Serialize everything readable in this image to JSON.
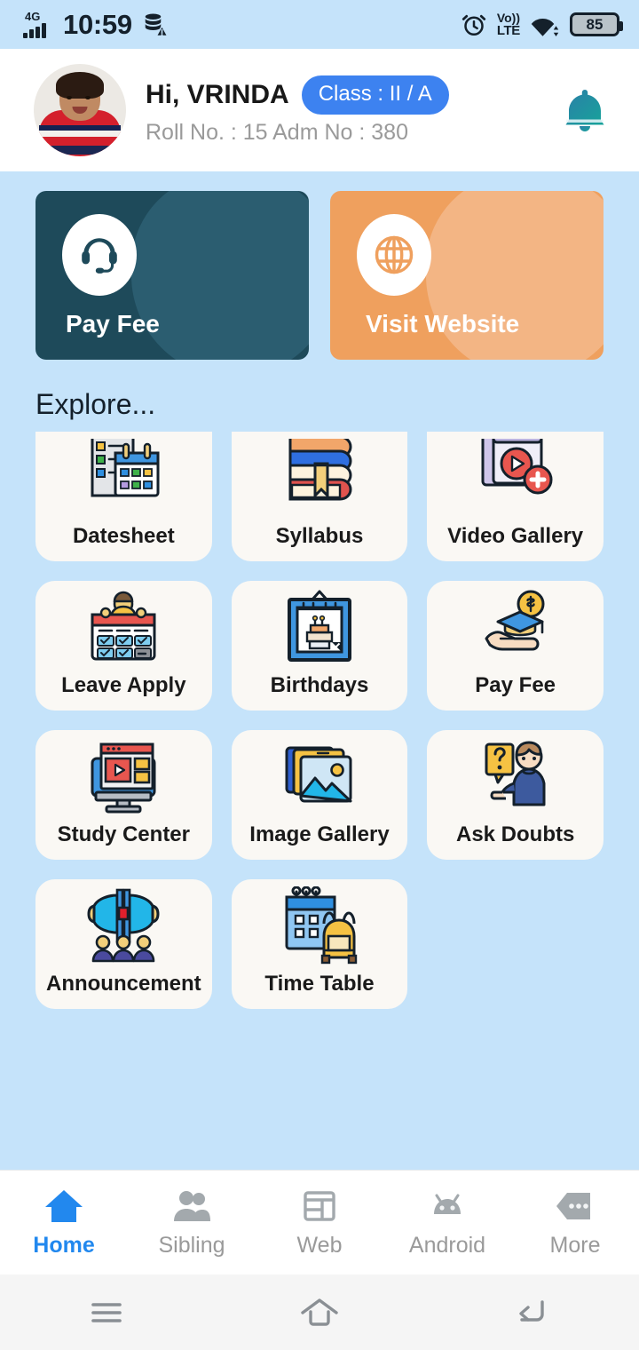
{
  "statusbar": {
    "network": "4G",
    "time": "10:59",
    "data_icon": "data-saver-off-icon",
    "alarm_icon": "alarm-icon",
    "volte_top": "Vo))",
    "volte_bottom": "LTE",
    "wifi_icon": "wifi-icon",
    "battery_level": "85"
  },
  "header": {
    "avatar_alt": "student-photo",
    "greeting": "Hi, VRINDA",
    "class_badge": "Class : II / A",
    "sub_info": "Roll No. : 15  Adm No : 380",
    "bell_icon": "notification-bell-icon"
  },
  "promos": [
    {
      "label": "Pay Fee",
      "icon": "headset-support-icon",
      "bg": "#1e4a5a",
      "wave": "#2b5d70"
    },
    {
      "label": "Visit Website",
      "icon": "globe-icon",
      "bg": "#efa05e",
      "wave": "#f3b584"
    }
  ],
  "explore": {
    "title": "Explore...",
    "tiles": [
      {
        "label": "Datesheet",
        "icon": "datesheet-calendar-icon"
      },
      {
        "label": "Syllabus",
        "icon": "books-stack-icon"
      },
      {
        "label": "Video Gallery",
        "icon": "video-gallery-icon"
      },
      {
        "label": "Leave Apply",
        "icon": "leave-apply-icon"
      },
      {
        "label": "Birthdays",
        "icon": "birthday-cake-icon"
      },
      {
        "label": "Pay Fee",
        "icon": "hand-graduation-coin-icon"
      },
      {
        "label": "Study Center",
        "icon": "study-center-monitor-icon"
      },
      {
        "label": "Image Gallery",
        "icon": "image-gallery-icon"
      },
      {
        "label": "Ask Doubts",
        "icon": "ask-doubts-person-icon"
      },
      {
        "label": "Announcement",
        "icon": "announcement-megaphone-icon"
      },
      {
        "label": "Time Table",
        "icon": "timetable-backpack-icon"
      }
    ]
  },
  "bottomnav": {
    "items": [
      {
        "label": "Home",
        "icon": "home-icon",
        "active": true
      },
      {
        "label": "Sibling",
        "icon": "people-icon",
        "active": false
      },
      {
        "label": "Web",
        "icon": "web-layout-icon",
        "active": false
      },
      {
        "label": "Android",
        "icon": "android-icon",
        "active": false
      },
      {
        "label": "More",
        "icon": "more-dots-icon",
        "active": false
      }
    ],
    "active_color": "#2288ee",
    "inactive_color": "#9a9a9a"
  },
  "sysnav": {
    "recents_icon": "menu-recents-icon",
    "home_icon": "home-outline-icon",
    "back_icon": "back-arrow-icon"
  },
  "colors": {
    "page_bg": "#c5e3fa",
    "card_bg": "#faf8f4",
    "badge_blue": "#3d82f0",
    "header_white": "#ffffff"
  }
}
